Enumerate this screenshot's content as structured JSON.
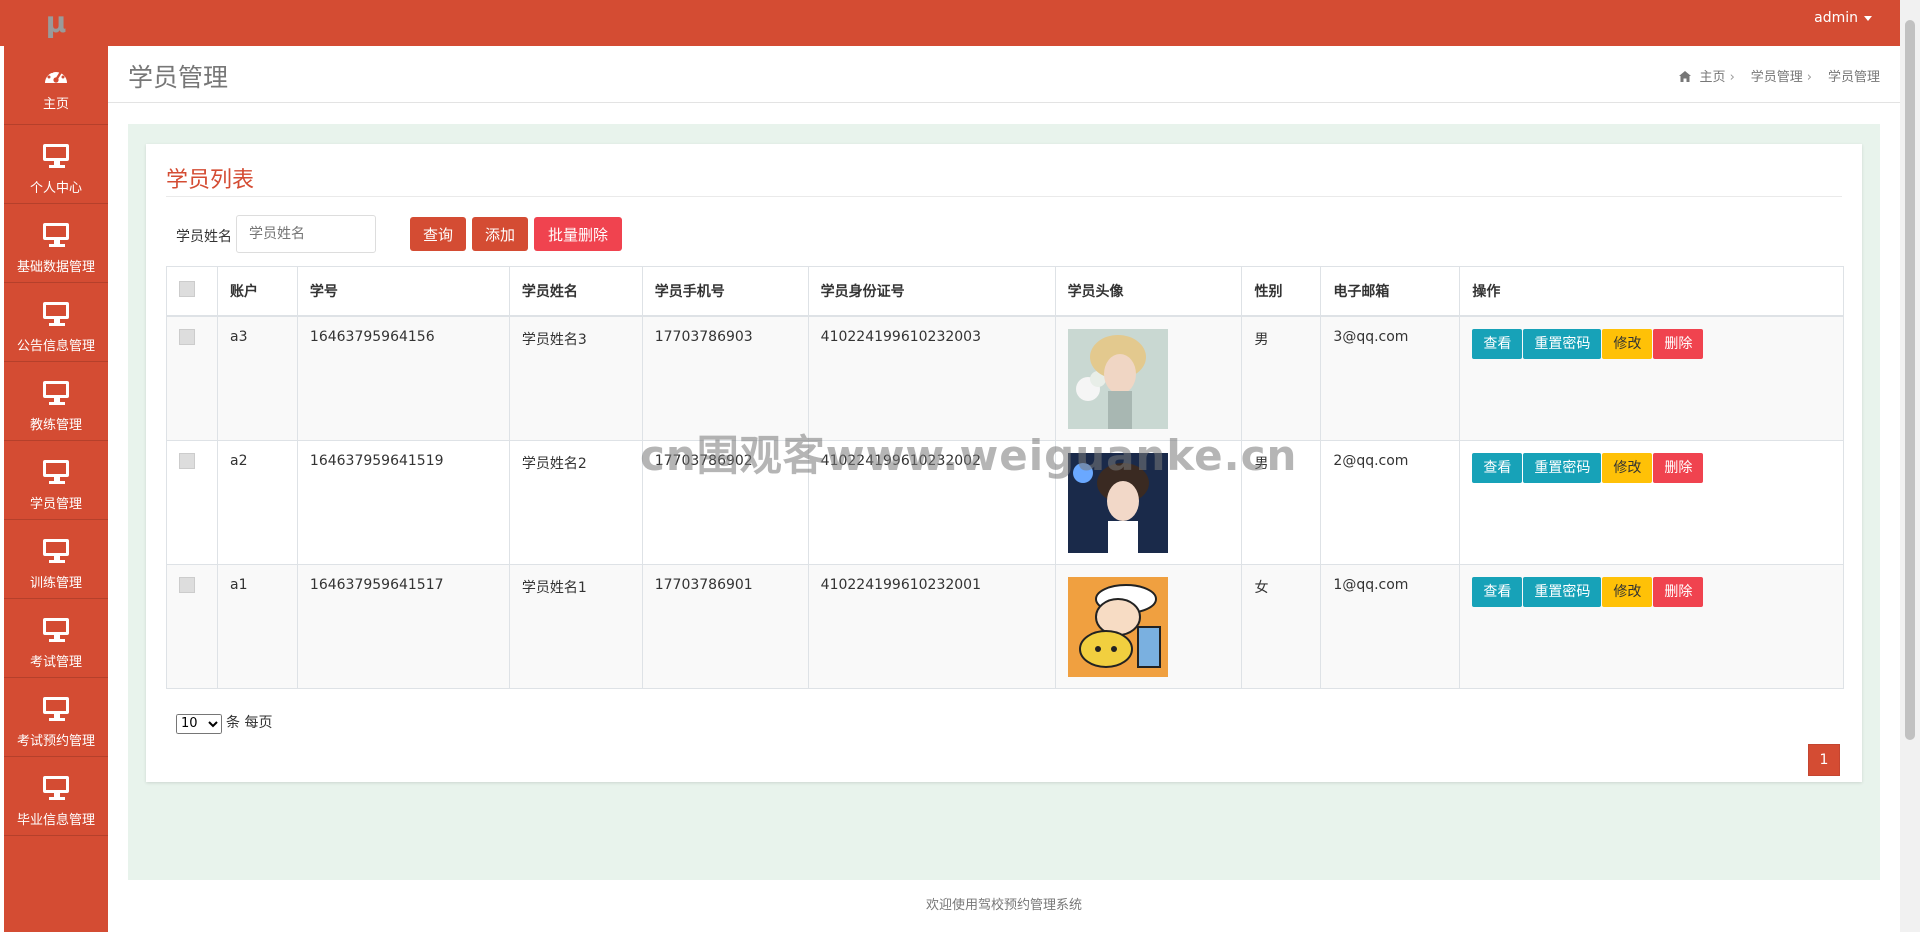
{
  "brand": {
    "logo_glyph": "μ"
  },
  "topbar": {
    "user": "admin"
  },
  "sidebar": {
    "items": [
      {
        "label": "主页",
        "icon": "dashboard-icon"
      },
      {
        "label": "个人中心",
        "icon": "monitor-icon"
      },
      {
        "label": "基础数据管理",
        "icon": "monitor-icon"
      },
      {
        "label": "公告信息管理",
        "icon": "monitor-icon"
      },
      {
        "label": "教练管理",
        "icon": "monitor-icon"
      },
      {
        "label": "学员管理",
        "icon": "monitor-icon"
      },
      {
        "label": "训练管理",
        "icon": "monitor-icon"
      },
      {
        "label": "考试管理",
        "icon": "monitor-icon"
      },
      {
        "label": "考试预约管理",
        "icon": "monitor-icon"
      },
      {
        "label": "毕业信息管理",
        "icon": "monitor-icon"
      }
    ]
  },
  "header": {
    "title": "学员管理",
    "breadcrumb": [
      "主页",
      "学员管理",
      "学员管理"
    ]
  },
  "card": {
    "title": "学员列表"
  },
  "search": {
    "label": "学员姓名",
    "placeholder": "学员姓名",
    "query_label": "查询",
    "add_label": "添加",
    "batch_delete_label": "批量删除"
  },
  "table": {
    "columns": [
      "账户",
      "学号",
      "学员姓名",
      "学员手机号",
      "学员身份证号",
      "学员头像",
      "性别",
      "电子邮箱",
      "操作"
    ],
    "rows": [
      {
        "account": "a3",
        "student_no": "16463795964156",
        "name": "学员姓名3",
        "phone": "17703786903",
        "id_card": "410224199610232003",
        "gender": "男",
        "email": "3@qq.com"
      },
      {
        "account": "a2",
        "student_no": "164637959641519",
        "name": "学员姓名2",
        "phone": "17703786902",
        "id_card": "410224199610232002",
        "gender": "男",
        "email": "2@qq.com"
      },
      {
        "account": "a1",
        "student_no": "164637959641517",
        "name": "学员姓名1",
        "phone": "17703786901",
        "id_card": "410224199610232001",
        "gender": "女",
        "email": "1@qq.com"
      }
    ],
    "actions": {
      "view": "查看",
      "reset": "重置密码",
      "edit": "修改",
      "delete": "删除"
    }
  },
  "pagination": {
    "page_size": "10",
    "suffix": "条 每页",
    "current_page": "1"
  },
  "footer": {
    "text": "欢迎使用驾校预约管理系统"
  },
  "watermark": {
    "text": "cn围观客www.weiguanke.cn"
  },
  "colors": {
    "primary": "#d44c33",
    "info": "#17a2b8",
    "warning": "#ffc107",
    "danger": "#f0434f",
    "content_bg": "#e8f3ec"
  }
}
